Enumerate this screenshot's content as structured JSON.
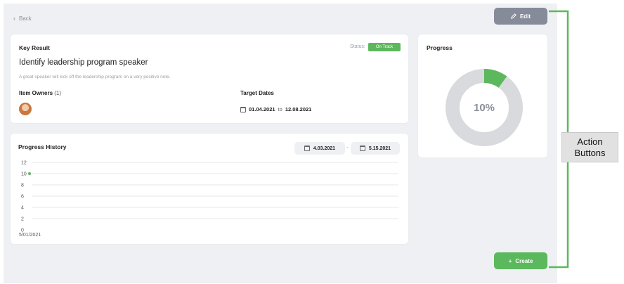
{
  "nav": {
    "back_label": "Back"
  },
  "actions": {
    "edit_label": "Edit",
    "create_label": "Create"
  },
  "key_result": {
    "heading": "Key Result",
    "status_label": "Status:",
    "status_value": "On Track",
    "title": "Identify leadership program speaker",
    "description": "A great speaker will kick off the leadership program on a very positive note.",
    "owners_heading": "Item Owners",
    "owners_count": "(1)",
    "target_heading": "Target Dates",
    "start_date": "01.04.2021",
    "to": "to",
    "end_date": "12.08.2021"
  },
  "progress_history": {
    "heading": "Progress History",
    "from_date": "4.03.2021",
    "separator": "-",
    "to_date": "5.15.2021"
  },
  "chart_data": {
    "type": "scatter",
    "title": "Progress History",
    "x": [
      "5/01/2021"
    ],
    "y": [
      10
    ],
    "ylim": [
      0,
      12
    ],
    "yticks": [
      "12",
      "10",
      "8",
      "6",
      "4",
      "2",
      "0"
    ],
    "xticks": [
      "5/01/2021"
    ],
    "grid": true,
    "color": "#5cb85c"
  },
  "progress": {
    "heading": "Progress",
    "value": 10,
    "value_label": "10%",
    "fill_color": "#5cb85c",
    "track_color": "#d9dadd"
  },
  "annotation": {
    "line1": "Action",
    "line2": "Buttons",
    "bracket_color": "#5cb85c"
  }
}
